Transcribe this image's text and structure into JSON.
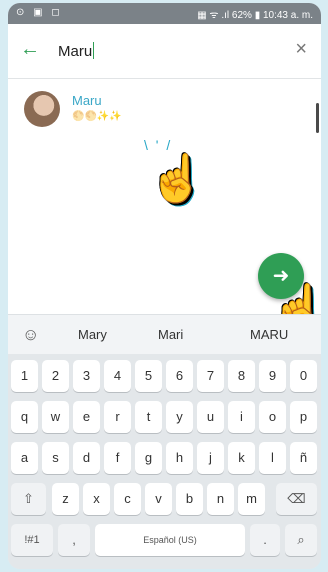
{
  "status_bar": {
    "left_icons": "⊙ ▣ ◻",
    "right_text": "▦ ᯤ .ıl 62% ▮ 10:43 a. m."
  },
  "search": {
    "query": "Maru",
    "back_icon": "arrow-left-icon",
    "clear_icon": "close-icon"
  },
  "results": [
    {
      "name": "Maru",
      "status_text": "🌕🌕",
      "status_sparkles": "✨✨"
    }
  ],
  "fab": {
    "icon": "send-arrow-icon",
    "glyph": "➜",
    "color": "#2f9e55"
  },
  "suggestions": {
    "icon": "emoji-icon",
    "glyph": "☺",
    "items": [
      "Mary",
      "Mari",
      "MARU"
    ]
  },
  "keyboard": {
    "row1": [
      "1",
      "2",
      "3",
      "4",
      "5",
      "6",
      "7",
      "8",
      "9",
      "0"
    ],
    "row2": [
      "q",
      "w",
      "e",
      "r",
      "t",
      "y",
      "u",
      "i",
      "o",
      "p"
    ],
    "row3": [
      "a",
      "s",
      "d",
      "f",
      "g",
      "h",
      "j",
      "k",
      "l",
      "ñ"
    ],
    "row4": [
      "⇧",
      "z",
      "x",
      "c",
      "v",
      "b",
      "n",
      "m",
      "⌫"
    ],
    "row5": [
      "!#1",
      ",",
      "Español (US)",
      ".",
      "⌕"
    ]
  },
  "accent_color": "#2f9e55",
  "hand_glyph": "☝",
  "tap_glyph": "\\ ' /"
}
